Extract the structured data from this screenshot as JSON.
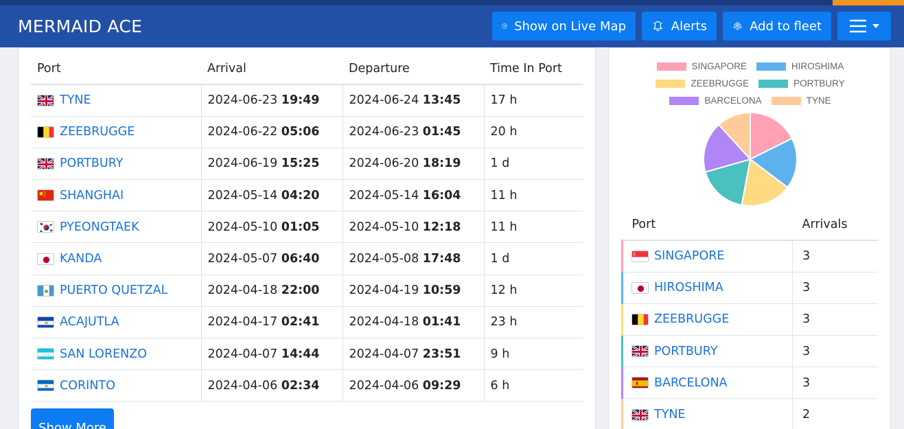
{
  "header": {
    "vessel_name": "MERMAID ACE",
    "buttons": {
      "live_map": "Show on Live Map",
      "alerts": "Alerts",
      "add_fleet": "Add to fleet"
    }
  },
  "port_calls": {
    "columns": [
      "Port",
      "Arrival",
      "Departure",
      "Time In Port"
    ],
    "rows": [
      {
        "flag": "GB",
        "port": "TYNE",
        "arr_date": "2024-06-23",
        "arr_time": "19:49",
        "dep_date": "2024-06-24",
        "dep_time": "13:45",
        "duration": "17 h"
      },
      {
        "flag": "BE",
        "port": "ZEEBRUGGE",
        "arr_date": "2024-06-22",
        "arr_time": "05:06",
        "dep_date": "2024-06-23",
        "dep_time": "01:45",
        "duration": "20 h"
      },
      {
        "flag": "GB",
        "port": "PORTBURY",
        "arr_date": "2024-06-19",
        "arr_time": "15:25",
        "dep_date": "2024-06-20",
        "dep_time": "18:19",
        "duration": "1 d"
      },
      {
        "flag": "CN",
        "port": "SHANGHAI",
        "arr_date": "2024-05-14",
        "arr_time": "04:20",
        "dep_date": "2024-05-14",
        "dep_time": "16:04",
        "duration": "11 h"
      },
      {
        "flag": "KR",
        "port": "PYEONGTAEK",
        "arr_date": "2024-05-10",
        "arr_time": "01:05",
        "dep_date": "2024-05-10",
        "dep_time": "12:18",
        "duration": "11 h"
      },
      {
        "flag": "JP",
        "port": "KANDA",
        "arr_date": "2024-05-07",
        "arr_time": "06:40",
        "dep_date": "2024-05-08",
        "dep_time": "17:48",
        "duration": "1 d"
      },
      {
        "flag": "GT",
        "port": "PUERTO QUETZAL",
        "arr_date": "2024-04-18",
        "arr_time": "22:00",
        "dep_date": "2024-04-19",
        "dep_time": "10:59",
        "duration": "12 h"
      },
      {
        "flag": "SV",
        "port": "ACAJUTLA",
        "arr_date": "2024-04-17",
        "arr_time": "02:41",
        "dep_date": "2024-04-18",
        "dep_time": "01:41",
        "duration": "23 h"
      },
      {
        "flag": "HN",
        "port": "SAN LORENZO",
        "arr_date": "2024-04-07",
        "arr_time": "14:44",
        "dep_date": "2024-04-07",
        "dep_time": "23:51",
        "duration": "9 h"
      },
      {
        "flag": "NI",
        "port": "CORINTO",
        "arr_date": "2024-04-06",
        "arr_time": "02:34",
        "dep_date": "2024-04-06",
        "dep_time": "09:29",
        "duration": "6 h"
      }
    ],
    "show_more": "Show More"
  },
  "chart_data": {
    "type": "pie",
    "categories": [
      "SINGAPORE",
      "HIROSHIMA",
      "ZEEBRUGGE",
      "PORTBURY",
      "BARCELONA",
      "TYNE"
    ],
    "values": [
      3,
      3,
      3,
      3,
      3,
      2
    ],
    "colors": [
      "#ffa1b5",
      "#5eb1ef",
      "#ffda80",
      "#4bc0c0",
      "#b085f5",
      "#ffcc99"
    ],
    "legend_position": "top"
  },
  "arrivals": {
    "columns": [
      "Port",
      "Arrivals"
    ],
    "rows": [
      {
        "flag": "SG",
        "port": "SINGAPORE",
        "count": "3",
        "color": "#ffa1b5"
      },
      {
        "flag": "JP",
        "port": "HIROSHIMA",
        "count": "3",
        "color": "#5eb1ef"
      },
      {
        "flag": "BE",
        "port": "ZEEBRUGGE",
        "count": "3",
        "color": "#ffda80"
      },
      {
        "flag": "GB",
        "port": "PORTBURY",
        "count": "3",
        "color": "#4bc0c0"
      },
      {
        "flag": "ES",
        "port": "BARCELONA",
        "count": "3",
        "color": "#b085f5"
      },
      {
        "flag": "GB",
        "port": "TYNE",
        "count": "2",
        "color": "#ffcc99"
      }
    ]
  }
}
